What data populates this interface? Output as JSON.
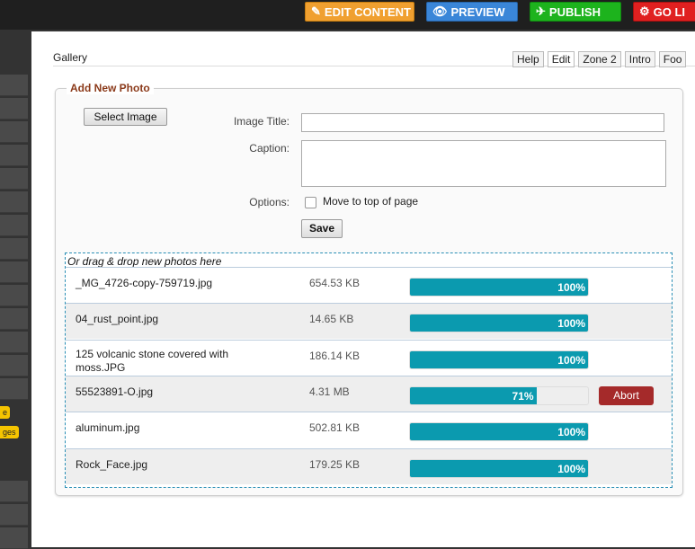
{
  "toolbar": {
    "edit_content": "EDIT CONTENT",
    "preview": "PREVIEW",
    "publish": "PUBLISH",
    "go_live": "GO LI"
  },
  "sidebar": {
    "badge1": "e",
    "badge2": "ges"
  },
  "page": {
    "title": "Gallery",
    "tabs": [
      "Help",
      "Edit",
      "Zone 2",
      "Intro",
      "Foo"
    ]
  },
  "form": {
    "legend": "Add New Photo",
    "select_image": "Select Image",
    "image_title_label": "Image Title:",
    "image_title_value": "",
    "caption_label": "Caption:",
    "caption_value": "",
    "options_label": "Options:",
    "move_to_top_label": "Move to top of page",
    "save_label": "Save"
  },
  "uploads": {
    "drop_hint": "Or drag & drop new photos here",
    "abort_label": "Abort",
    "files": [
      {
        "name": "_MG_4726-copy-759719.jpg",
        "size": "654.53 KB",
        "progress": 100,
        "progress_label": "100%"
      },
      {
        "name": "04_rust_point.jpg",
        "size": "14.65 KB",
        "progress": 100,
        "progress_label": "100%"
      },
      {
        "name": "125 volcanic stone covered with moss.JPG",
        "size": "186.14 KB",
        "progress": 100,
        "progress_label": "100%"
      },
      {
        "name": "55523891-O.jpg",
        "size": "4.31 MB",
        "progress": 71,
        "progress_label": "71%"
      },
      {
        "name": "aluminum.jpg",
        "size": "502.81 KB",
        "progress": 100,
        "progress_label": "100%"
      },
      {
        "name": "Rock_Face.jpg",
        "size": "179.25 KB",
        "progress": 100,
        "progress_label": "100%"
      }
    ]
  },
  "colors": {
    "progress": "#0b9aaf",
    "abort": "#a52a2a",
    "legend": "#8b3a1a"
  }
}
